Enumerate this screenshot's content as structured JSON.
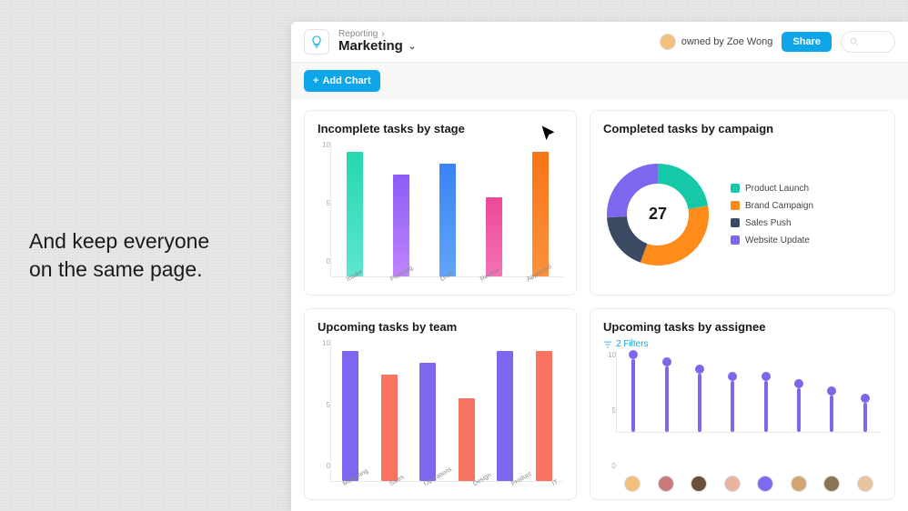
{
  "hero": {
    "line1": "And keep everyone",
    "line2": "on the same page."
  },
  "header": {
    "breadcrumb": "Reporting",
    "title": "Marketing",
    "owner_label": "owned by Zoe Wong",
    "share": "Share"
  },
  "toolbar": {
    "add_chart": "Add Chart"
  },
  "cards": {
    "incomplete": {
      "title": "Incomplete tasks by stage",
      "chart_data": {
        "type": "bar",
        "categories": [
          "Intake",
          "Planning",
          "Draft",
          "Review",
          "Approved"
        ],
        "values": [
          11,
          9,
          10,
          7,
          11
        ],
        "ylim": [
          0,
          12
        ],
        "yticks": [
          10,
          5,
          0
        ],
        "colors": [
          "grad-teal",
          "grad-purple",
          "grad-blue",
          "grad-pink",
          "grad-orange"
        ]
      }
    },
    "completed": {
      "title": "Completed tasks by campaign",
      "chart_data": {
        "type": "pie",
        "center_value": 27,
        "slices": [
          {
            "name": "Product Launch",
            "value": 6,
            "color": "#14c8a8"
          },
          {
            "name": "Brand Campaign",
            "value": 9,
            "color": "#ff8c1a"
          },
          {
            "name": "Sales Push",
            "value": 5,
            "color": "#3b4a63"
          },
          {
            "name": "Website Update",
            "value": 7,
            "color": "#7b68ee"
          }
        ]
      }
    },
    "by_team": {
      "title": "Upcoming tasks by team",
      "chart_data": {
        "type": "bar",
        "categories": [
          "Marketing",
          "Sales",
          "Operations",
          "Design",
          "Product",
          "IT"
        ],
        "values": [
          11,
          9,
          10,
          7,
          11,
          11
        ],
        "ylim": [
          0,
          12
        ],
        "yticks": [
          10,
          5,
          0
        ],
        "series_colors": [
          "bar-purple",
          "bar-salmon",
          "bar-purple",
          "bar-salmon",
          "bar-purple",
          "bar-salmon"
        ]
      }
    },
    "by_assignee": {
      "title": "Upcoming tasks by assignee",
      "filter_label": "2 Filters",
      "chart_data": {
        "type": "lollipop",
        "values": [
          10,
          9,
          8,
          7,
          7,
          6,
          5,
          4
        ],
        "ylim": [
          0,
          10
        ],
        "yticks": [
          10,
          5,
          0
        ],
        "assignee_colors": [
          "#f3c07b",
          "#c97b7b",
          "#6b4f3a",
          "#e8b4a0",
          "#7b6bf3",
          "#d4a574",
          "#8b7355",
          "#e8c4a0"
        ]
      }
    }
  }
}
